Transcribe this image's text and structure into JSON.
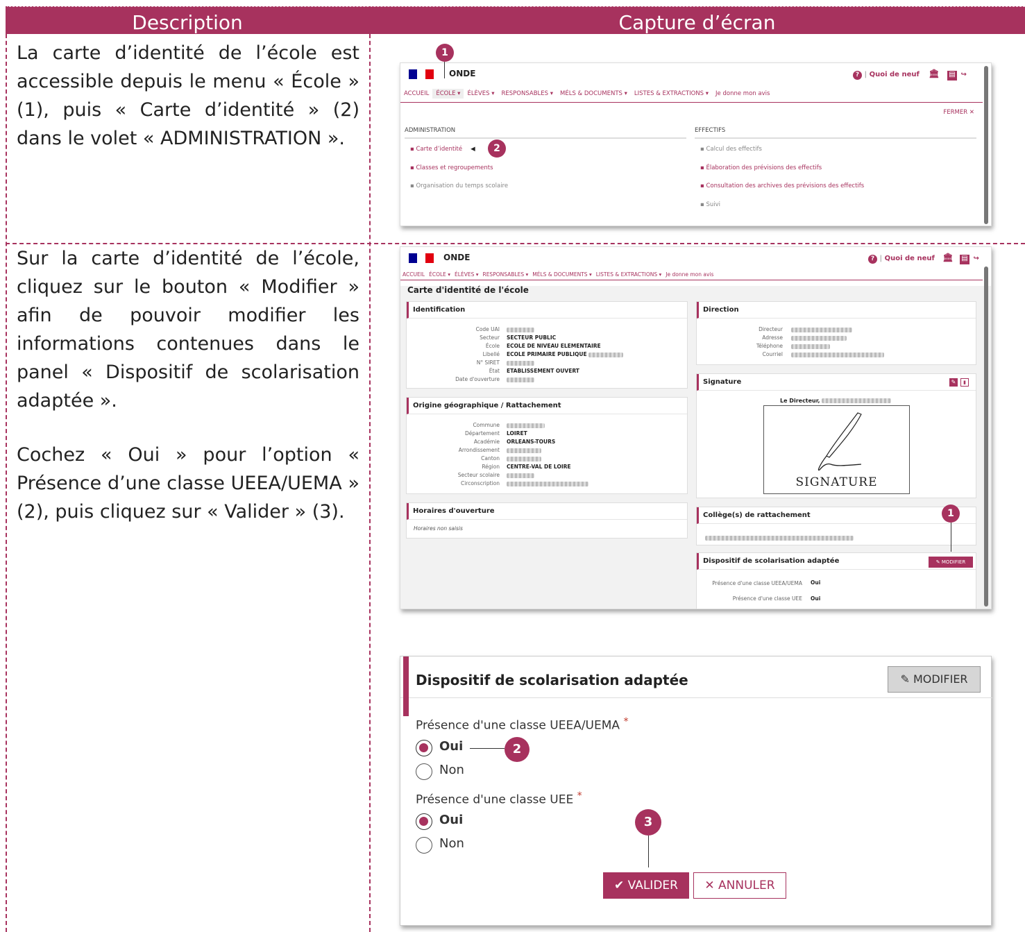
{
  "table": {
    "col1_header": "Description",
    "col2_header": "Capture d’écran",
    "row1_desc": "La carte d’identité de l’école est accessible depuis le menu « École » (1), puis « Carte d’identité » (2) dans le volet « ADMINISTRATION ».",
    "row2_desc_p1": "Sur la carte d’identité de l’école, cliquez sur le bouton « Modifier » afin de pouvoir modifier les informations contenues dans le panel « Dispositif de scolarisation adaptée ».",
    "row2_desc_p2": "Cochez « Oui » pour l’option « Présence d’une classe UEEA/UEMA » (2), puis cliquez sur « Valider » (3)."
  },
  "app": {
    "name": "ONDE",
    "quoi_de_neuf": "Quoi de neuf",
    "nav": [
      "ACCUEIL",
      "ÉCOLE ▾",
      "ÉLÈVES ▾",
      "RESPONSABLES ▾",
      "MÉLS & DOCUMENTS ▾",
      "LISTES & EXTRACTIONS ▾",
      "Je donne mon avis"
    ]
  },
  "shot1": {
    "badge1": "1",
    "badge2": "2",
    "fermer": "FERMER ✕",
    "admin_header": "ADMINISTRATION",
    "admin_items": [
      "▪ Carte d’identité",
      "▪ Classes et regroupements",
      "▪ Organisation du temps scolaire"
    ],
    "effectifs_header": "EFFECTIFS",
    "effectifs_items": [
      "▪ Calcul des effectifs",
      "▪ Élaboration des prévisions des effectifs",
      "▪ Consultation des archives des prévisions des effectifs",
      "▪ Suivi"
    ]
  },
  "shot2": {
    "title": "Carte d'identité de l'école",
    "identification": {
      "title": "Identification",
      "labels": [
        "Code UAI",
        "Secteur",
        "École",
        "Libellé",
        "N° SIRET",
        "État",
        "Date d'ouverture"
      ],
      "values": [
        "",
        "SECTEUR PUBLIC",
        "ECOLE DE NIVEAU ELEMENTAIRE",
        "ECOLE PRIMAIRE PUBLIQUE",
        "",
        "ETABLISSEMENT OUVERT",
        ""
      ]
    },
    "origine": {
      "title": "Origine géographique / Rattachement",
      "labels": [
        "Commune",
        "Département",
        "Académie",
        "Arrondissement",
        "Canton",
        "Région",
        "Secteur scolaire",
        "Circonscription"
      ],
      "values": [
        "",
        "LOIRET",
        "ORLEANS-TOURS",
        "",
        "",
        "CENTRE-VAL DE LOIRE",
        "",
        ""
      ]
    },
    "horaires": {
      "title": "Horaires d'ouverture",
      "text": "Horaires non saisis"
    },
    "direction": {
      "title": "Direction",
      "labels": [
        "Directeur",
        "Adresse",
        "Téléphone",
        "Courriel"
      ]
    },
    "signature": {
      "title": "Signature",
      "le_directeur": "Le Directeur,",
      "image_text": "SIGNATURE"
    },
    "college": {
      "title": "Collège(s) de rattachement"
    },
    "dispositif": {
      "title": "Dispositif de scolarisation adaptée",
      "modifier": "✎ MODIFIER",
      "row1_label": "Présence d'une classe UEEA/UEMA",
      "row1_value": "Oui",
      "row2_label": "Présence d'une classe UEE",
      "row2_value": "Oui"
    },
    "badge1": "1"
  },
  "shot3": {
    "title": "Dispositif de scolarisation adaptée",
    "modifier": "MODIFIER",
    "q1": "Présence d'une classe UEEA/UEMA",
    "q2": "Présence d'une classe UEE",
    "required": "*",
    "oui": "Oui",
    "non": "Non",
    "valider": "✔ VALIDER",
    "annuler": "✕ ANNULER",
    "badge2": "2",
    "badge3": "3",
    "q1_selected": "Oui",
    "q2_selected": "Oui"
  },
  "colors": {
    "accent": "#a7325e",
    "flag_blue": "#000091",
    "flag_red": "#e1000f"
  }
}
